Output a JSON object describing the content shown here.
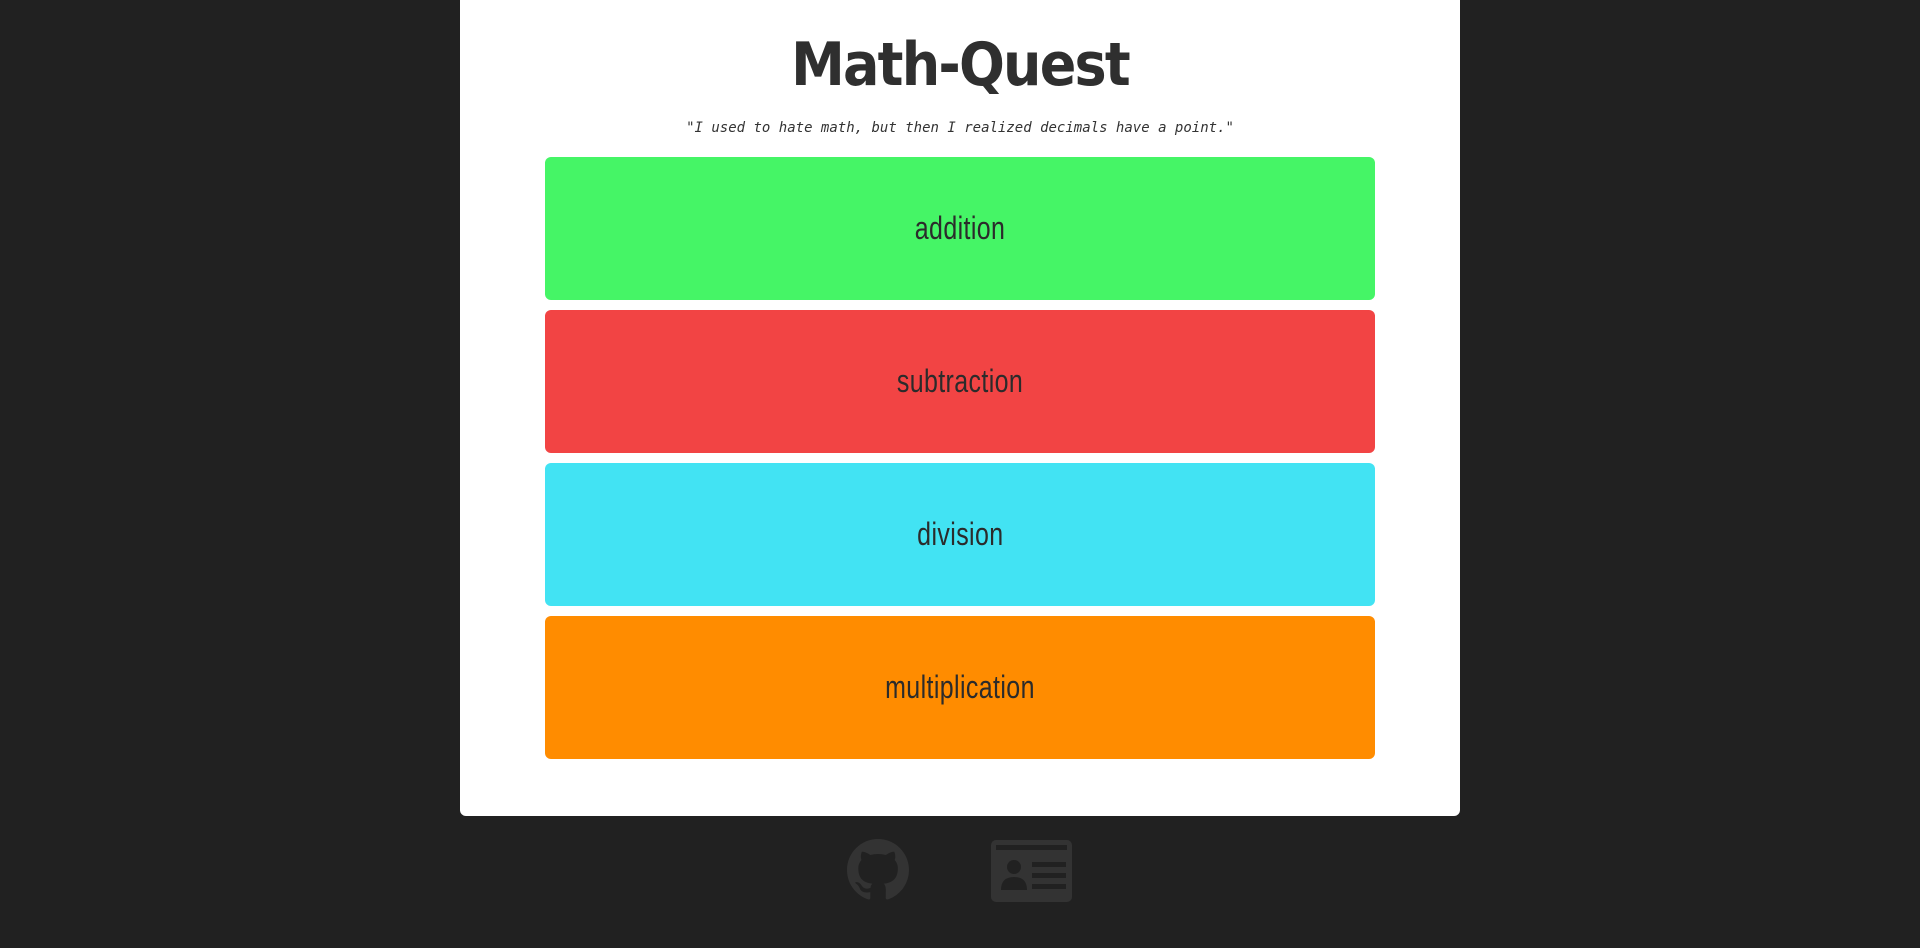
{
  "app": {
    "title": "Math-Quest",
    "quote": "\"I used to hate math, but then I realized decimals have a point.\""
  },
  "operations": [
    {
      "label": "addition",
      "color": "#45f566"
    },
    {
      "label": "subtraction",
      "color": "#f24444"
    },
    {
      "label": "division",
      "color": "#42e3f3"
    },
    {
      "label": "multiplication",
      "color": "#ff8c00"
    }
  ],
  "footer": {
    "icons": [
      "github-icon",
      "contact-card-icon"
    ],
    "icon_color": "#333333"
  },
  "colors": {
    "background": "#212121",
    "card": "#ffffff",
    "text": "#2f2f2f"
  }
}
